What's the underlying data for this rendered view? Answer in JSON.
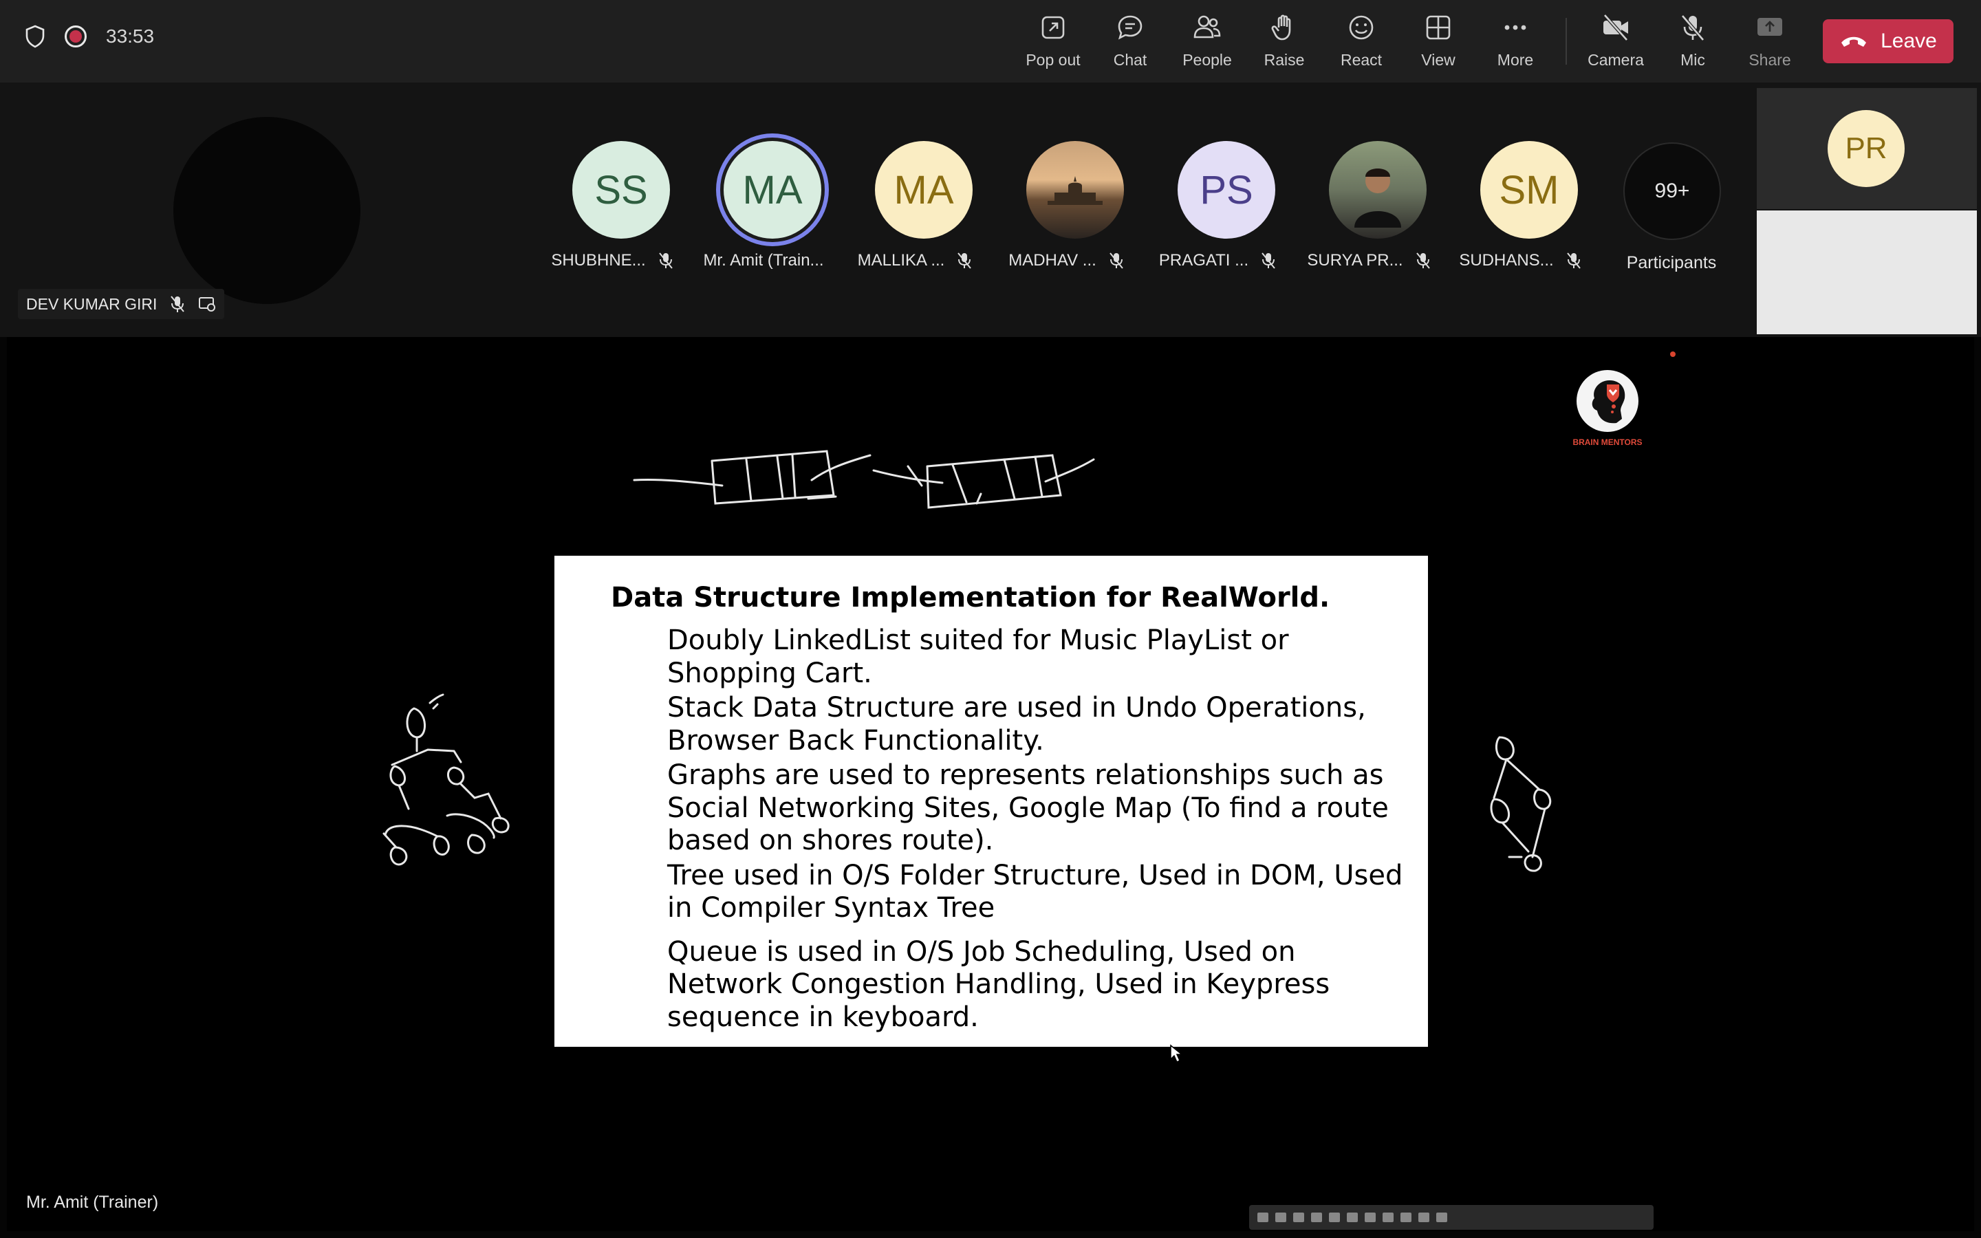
{
  "meeting": {
    "timer": "33:53"
  },
  "toolbar": {
    "popout": "Pop out",
    "chat": "Chat",
    "people": "People",
    "raise": "Raise",
    "react": "React",
    "view": "View",
    "more": "More",
    "camera": "Camera",
    "mic": "Mic",
    "share": "Share",
    "leave": "Leave"
  },
  "self": {
    "name": "DEV KUMAR GIRI"
  },
  "participants": [
    {
      "initials": "SS",
      "name": "SHUBHNE...",
      "bg": "#d9ede0",
      "fg": "#2f5e40"
    },
    {
      "initials": "MA",
      "name": "Mr. Amit (Train...",
      "bg": "#d9ede0",
      "fg": "#2f5e40"
    },
    {
      "initials": "MA",
      "name": "MALLIKA ...",
      "bg": "#faedc3",
      "fg": "#8a6d12"
    },
    {
      "initials": "",
      "name": "MADHAV ...",
      "bg": "#7a5a3a",
      "fg": "#fff"
    },
    {
      "initials": "PS",
      "name": "PRAGATI ...",
      "bg": "#e3def6",
      "fg": "#4b3f8a"
    },
    {
      "initials": "",
      "name": "SURYA PR...",
      "bg": "#6b7560",
      "fg": "#fff"
    },
    {
      "initials": "SM",
      "name": "SUDHANS...",
      "bg": "#faedc3",
      "fg": "#8a6d12"
    }
  ],
  "more_participants": {
    "count": "99+",
    "label": "Participants"
  },
  "side_tile": {
    "initials": "PR"
  },
  "slide": {
    "title": "Data Structure Implementation for RealWorld.",
    "bullets": [
      "Doubly LinkedList suited for Music PlayList or Shopping Cart.",
      "Stack Data Structure are used in Undo Operations, Browser Back Functionality.",
      "Graphs are used to represents relationships such as Social Networking Sites, Google Map (To find a route based on shores route).",
      "Tree used in O/S Folder Structure, Used in DOM, Used in Compiler Syntax Tree",
      "Queue is used in O/S Job Scheduling, Used on Network Congestion Handling, Used in Keypress sequence in keyboard."
    ]
  },
  "logo": {
    "text": "BRAIN MENTORS"
  },
  "presenter": {
    "name": "Mr. Amit (Trainer)"
  },
  "colors": {
    "leave": "#c4314b",
    "topbar": "#1f1f1f",
    "speaking_ring": "#7b83eb",
    "strip": "#141414"
  }
}
